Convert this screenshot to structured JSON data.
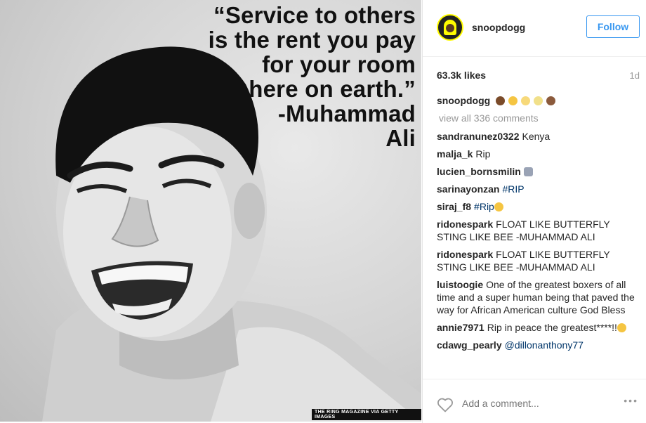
{
  "post": {
    "image_quote": [
      "“Service to others",
      "is the rent you pay",
      "for your room",
      "here on earth.”",
      "-Muhammad",
      "Ali"
    ],
    "image_credit": "THE RING MAGAZINE VIA GETTY IMAGES"
  },
  "header": {
    "username": "snoopdogg",
    "follow_label": "Follow"
  },
  "stats": {
    "likes": "63.3k likes",
    "time_ago": "1d"
  },
  "caption": {
    "username": "snoopdogg",
    "text": ""
  },
  "view_all_label": "view all 336 comments",
  "comments": [
    {
      "user": "sandranunez0322",
      "text": "Kenya"
    },
    {
      "user": "malja_k",
      "text": "Rip"
    },
    {
      "user": "lucien_bornsmilin",
      "text": ""
    },
    {
      "user": "sarinayonzan",
      "text": "#RIP"
    },
    {
      "user": "siraj_f8",
      "text": "#Rip"
    },
    {
      "user": "ridonespark",
      "text": "FLOAT LIKE BUTTERFLY STING LIKE BEE -MUHAMMAD ALI"
    },
    {
      "user": "ridonespark",
      "text": "FLOAT LIKE BUTTERFLY STING LIKE BEE -MUHAMMAD ALI"
    },
    {
      "user": "luistoogie",
      "text": "One of the greatest boxers of all time and a super human being that paved the way for African American culture God Bless"
    },
    {
      "user": "annie7971",
      "text": "Rip in peace the greatest****!!"
    },
    {
      "user": "cdawg_pearly",
      "text": "@dillonanthony77"
    }
  ],
  "footer": {
    "add_comment_placeholder": "Add a comment...",
    "more_label": "•••"
  },
  "icons": {
    "heart": "heart-icon",
    "more": "more-options-icon",
    "avatar": "snapcode-avatar"
  },
  "colors": {
    "accent": "#3897f0",
    "hashtag": "#003569",
    "muted": "#999999",
    "snap_yellow": "#fffc00"
  }
}
